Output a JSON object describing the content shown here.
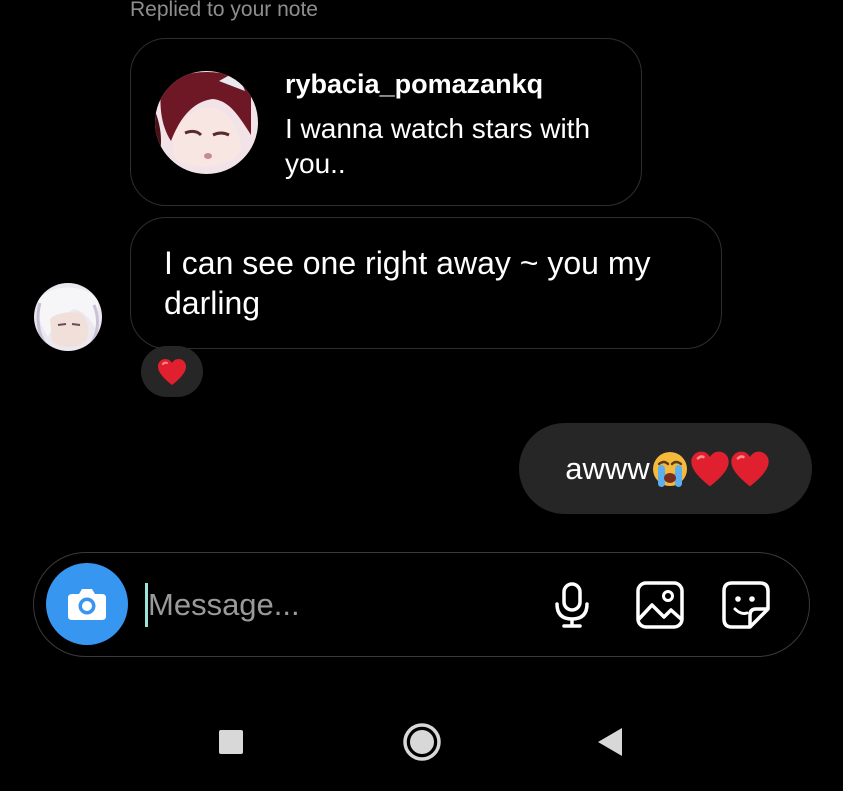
{
  "replied_label": "Replied to your note",
  "note": {
    "username": "rybacia_pomazankq",
    "text": "I wanna watch stars with you.."
  },
  "incoming_message": {
    "text": "I can see one right away ~ you my darling",
    "reaction_icon": "red-heart-emoji"
  },
  "outgoing_message": {
    "text": "awww",
    "emojis": [
      "loudly-crying-face-emoji",
      "red-heart-emoji",
      "red-heart-emoji"
    ]
  },
  "composer": {
    "placeholder": "Message...",
    "icons": [
      "camera-icon",
      "microphone-icon",
      "gallery-icon",
      "sticker-icon"
    ]
  },
  "navigation": {
    "icons": [
      "recents-square-icon",
      "home-circle-icon",
      "back-triangle-icon"
    ]
  },
  "colors": {
    "background": "#000000",
    "bubble_fill": "#262626",
    "bubble_border": "#2e2e2e",
    "accent_blue": "#3797f0",
    "secondary_text": "#8e8e8e",
    "heart_red": "#e0202e"
  }
}
